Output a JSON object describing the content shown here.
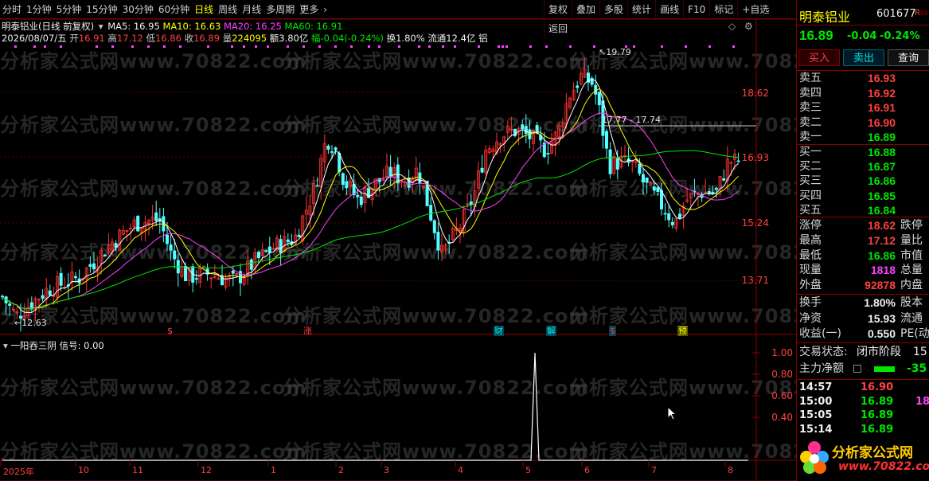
{
  "topbar": {
    "periods": [
      "分时",
      "1分钟",
      "5分钟",
      "15分钟",
      "30分钟",
      "60分钟",
      "日线",
      "周线",
      "月线",
      "多周期",
      "更多"
    ],
    "active_period": "日线",
    "tools": [
      "复权",
      "叠加",
      "多股",
      "统计",
      "画线",
      "F10",
      "标记",
      "+自选",
      "返回"
    ]
  },
  "chart_header": {
    "stock_title": "明泰铝业(日线 前复权)",
    "ma5": "MA5: 16.95",
    "ma10": "MA10: 16.63",
    "ma20": "MA20: 16.25",
    "ma60": "MA60: 16.91"
  },
  "day_info": {
    "date": "2026/08/07/五",
    "open_label": "开",
    "open": "16.91",
    "high_label": "高",
    "high": "17.12",
    "low_label": "低",
    "low": "16.86",
    "close_label": "收",
    "close": "16.89",
    "vol_label": "量",
    "vol": "224095",
    "amount": "额3.80亿",
    "change": "幅-0.04(-0.24%)",
    "turnover": "换1.80%",
    "float": "流通12.4亿 铝"
  },
  "price_axis": [
    "18.62",
    "16.93",
    "15.24",
    "13.71"
  ],
  "annotations": {
    "high_price": "19.79",
    "low_price": "12.63",
    "range_label": "17.77 - 17.74"
  },
  "events": [
    {
      "text": "$",
      "color": "#ff4040"
    },
    {
      "text": "涨",
      "color": "#ff4040"
    },
    {
      "text": "财",
      "color": "#00e5e5"
    },
    {
      "text": "解",
      "color": "#00e5e5"
    },
    {
      "text": "$",
      "color": "#ff4040"
    },
    {
      "text": "预",
      "color": "#ffff00"
    }
  ],
  "indicator": {
    "name": "一阳吞三阴",
    "signal": "信号: 0.00",
    "axis": [
      "1.00",
      "0.80",
      "0.60",
      "0.40"
    ]
  },
  "time_axis": [
    "2025年",
    "10",
    "11",
    "12",
    "1",
    "2",
    "3",
    "4",
    "5",
    "6",
    "7",
    "8"
  ],
  "watermark": "分析家公式网www.70822.com",
  "quote_panel": {
    "name": "明泰铝业",
    "code": "601677",
    "tag": "R",
    "price": "16.89",
    "change": "-0.04",
    "pct": "-0.24%",
    "buttons": [
      "买入",
      "卖出",
      "查询"
    ],
    "asks": [
      {
        "label": "卖五",
        "price": "16.93"
      },
      {
        "label": "卖四",
        "price": "16.92"
      },
      {
        "label": "卖三",
        "price": "16.91"
      },
      {
        "label": "卖二",
        "price": "16.90"
      },
      {
        "label": "卖一",
        "price": "16.89"
      }
    ],
    "bids": [
      {
        "label": "买一",
        "price": "16.88"
      },
      {
        "label": "买二",
        "price": "16.87"
      },
      {
        "label": "买三",
        "price": "16.86"
      },
      {
        "label": "买四",
        "price": "16.85"
      },
      {
        "label": "买五",
        "price": "16.84"
      }
    ],
    "stats": [
      {
        "label": "涨停",
        "value": "18.62",
        "color": "#ff4040",
        "label2": "跌停"
      },
      {
        "label": "最高",
        "value": "17.12",
        "color": "#ff4040",
        "label2": "量比"
      },
      {
        "label": "最低",
        "value": "16.86",
        "color": "#00e600",
        "label2": "市值"
      },
      {
        "label": "现量",
        "value": "1818",
        "color": "#ff40ff",
        "label2": "总量"
      },
      {
        "label": "外盘",
        "value": "92878",
        "color": "#ff4040",
        "label2": "内盘"
      }
    ],
    "stats2": [
      {
        "label": "换手",
        "value": "1.80%",
        "color": "#f0f0f0",
        "label2": "股本"
      },
      {
        "label": "净资",
        "value": "15.93",
        "color": "#f0f0f0",
        "label2": "流通"
      },
      {
        "label": "收益(一)",
        "value": "0.550",
        "color": "#f0f0f0",
        "label2": "PE(动"
      }
    ],
    "trade_status_label": "交易状态:",
    "trade_status": "闭市阶段",
    "trade_status_num": "15",
    "main_flow_label": "主力净额",
    "main_flow_value": "-35",
    "ticks": [
      {
        "time": "14:57",
        "price": "16.90",
        "vol": ""
      },
      {
        "time": "15:00",
        "price": "16.89",
        "vol": "18"
      },
      {
        "time": "15:05",
        "price": "16.89",
        "vol": ""
      },
      {
        "time": "15:14",
        "price": "16.89",
        "vol": ""
      }
    ],
    "logo_cn": "分析家公式网",
    "logo_url": "www.70822.com"
  },
  "chart_data": {
    "type": "candlestick",
    "ohlc_last": {
      "open": 16.91,
      "high": 17.12,
      "low": 16.86,
      "close": 16.89
    },
    "price_high": 19.79,
    "price_low": 12.63,
    "price_axis_ticks": [
      18.62,
      16.93,
      15.24,
      13.71
    ],
    "ma": {
      "MA5": 16.95,
      "MA10": 16.63,
      "MA20": 16.25,
      "MA60": 16.91
    },
    "indicator_signal_peak": 1.0,
    "colors": {
      "up": "#ff3232",
      "down": "#54ffff",
      "ma5": "#ffffff",
      "ma10": "#ffff00",
      "ma20": "#ff40ff",
      "ma60": "#00e600"
    }
  }
}
